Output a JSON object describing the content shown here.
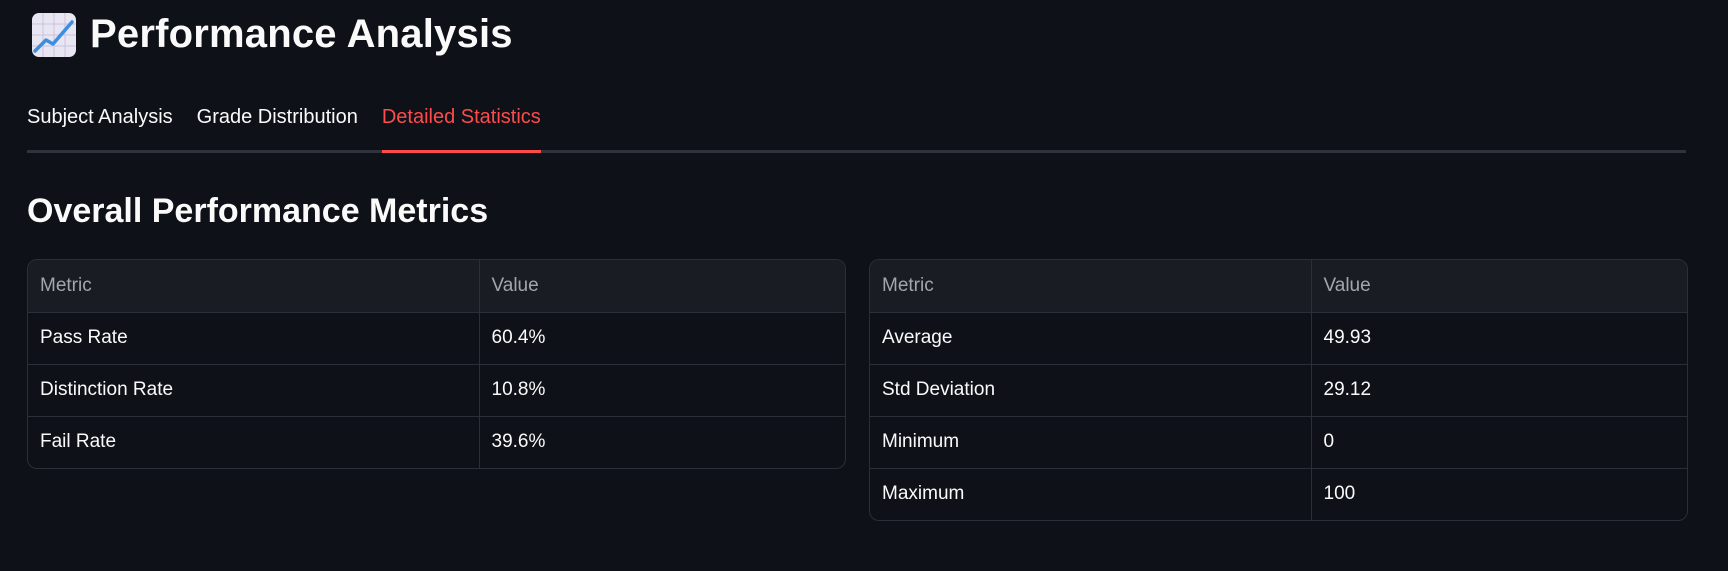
{
  "header": {
    "icon": "chart-increasing-icon",
    "title": "Performance Analysis"
  },
  "tabs": [
    {
      "label": "Subject Analysis",
      "active": false
    },
    {
      "label": "Grade Distribution",
      "active": false
    },
    {
      "label": "Detailed Statistics",
      "active": true
    }
  ],
  "section": {
    "title": "Overall Performance Metrics"
  },
  "tables": {
    "left": {
      "columns": [
        "Metric",
        "Value"
      ],
      "rows": [
        [
          "Pass Rate",
          "60.4%"
        ],
        [
          "Distinction Rate",
          "10.8%"
        ],
        [
          "Fail Rate",
          "39.6%"
        ]
      ]
    },
    "right": {
      "columns": [
        "Metric",
        "Value"
      ],
      "rows": [
        [
          "Average",
          "49.93"
        ],
        [
          "Std Deviation",
          "29.12"
        ],
        [
          "Minimum",
          "0"
        ],
        [
          "Maximum",
          "100"
        ]
      ]
    }
  },
  "colors": {
    "background": "#0e1117",
    "accent": "#ff4b4b",
    "text": "#fafafa",
    "header_text": "#a3a6ad"
  }
}
